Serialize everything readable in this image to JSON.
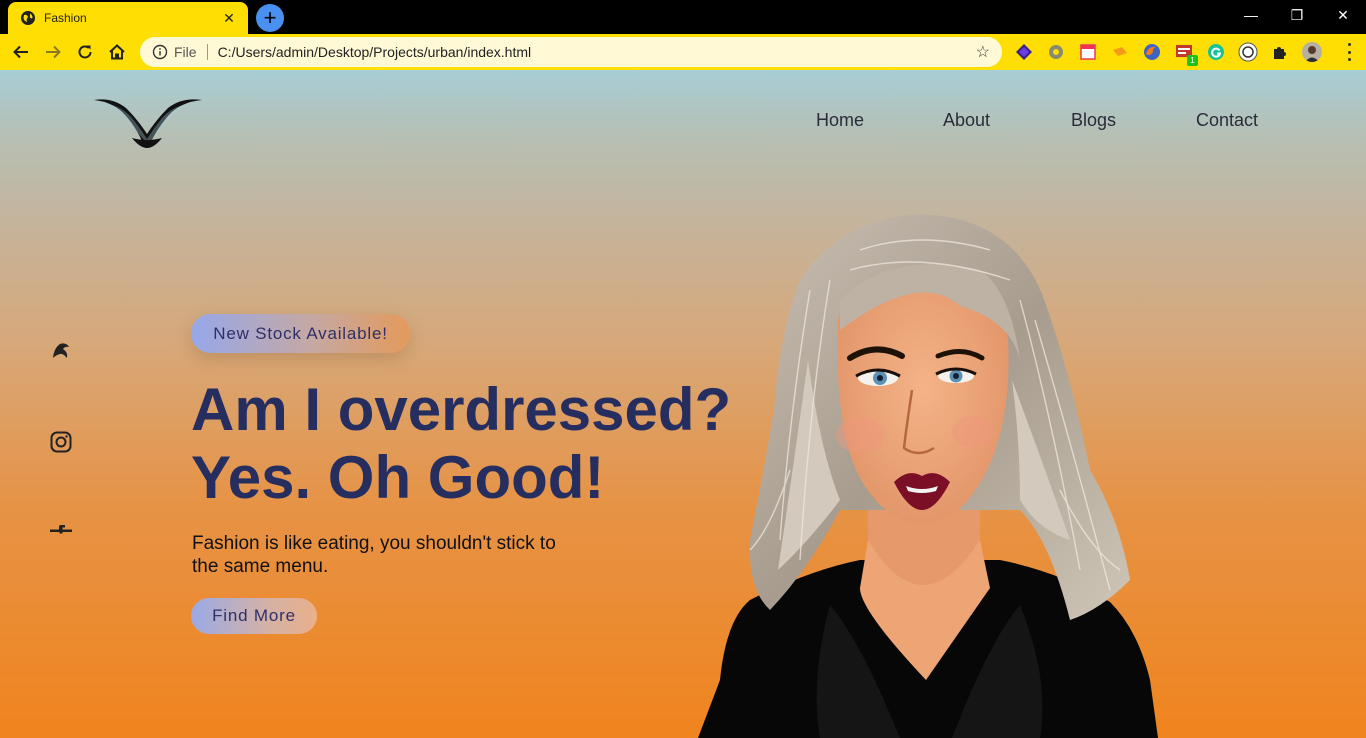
{
  "browser": {
    "tab_title": "Fashion",
    "tab_close": "✕",
    "new_tab": "+",
    "scheme_label": "File",
    "url": "C:/Users/admin/Desktop/Projects/urban/index.html",
    "star": "☆",
    "extension_badge": "1",
    "window_controls": {
      "minimize": "—",
      "restore": "❐",
      "close": "✕"
    }
  },
  "nav": {
    "items": [
      {
        "label": "Home"
      },
      {
        "label": "About"
      },
      {
        "label": "Blogs"
      },
      {
        "label": "Contact"
      }
    ]
  },
  "social": [
    "bird-icon",
    "instagram-icon",
    "facebook-icon"
  ],
  "hero": {
    "badge": "New Stock Available!",
    "headline_line1": "Am I overdressed?",
    "headline_line2": "Yes. Oh Good!",
    "tagline": "Fashion is like eating, you shouldn't stick to the same menu.",
    "cta": "Find More"
  },
  "colors": {
    "accent_yellow": "#ffde03",
    "headline": "#262e60",
    "gradient_top": "#a8cdd6",
    "gradient_bottom": "#f0841e"
  }
}
